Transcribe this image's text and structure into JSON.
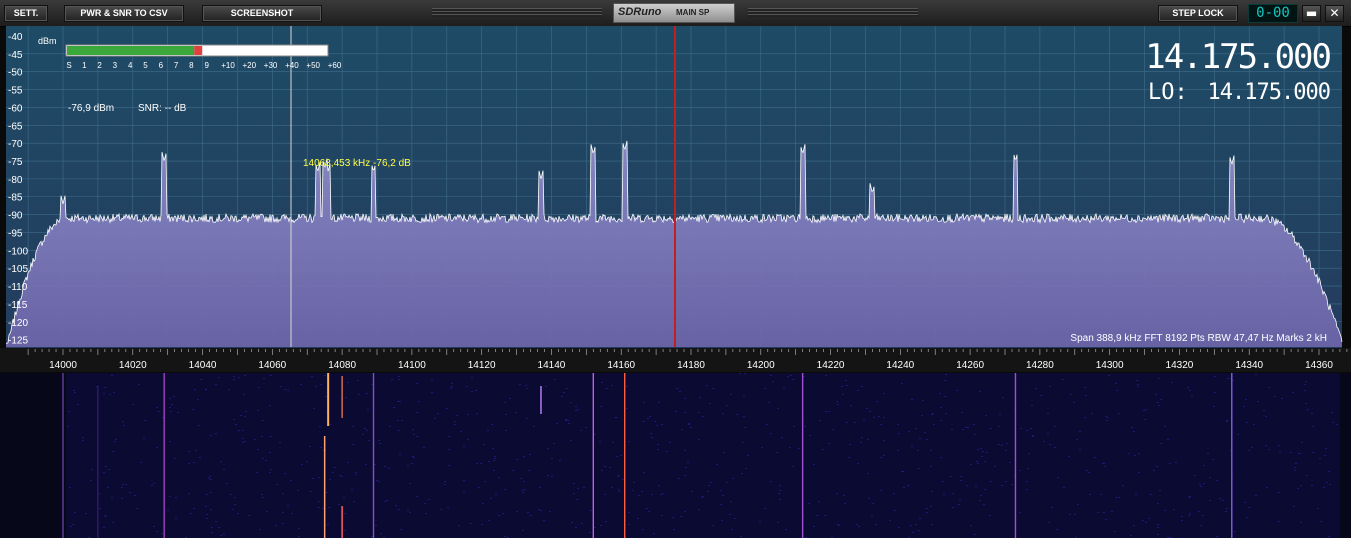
{
  "toolbar": {
    "settings_label": "SETT.",
    "csv_label": "PWR & SNR TO CSV",
    "screenshot_label": "SCREENSHOT",
    "brand_logo": "SDRuno",
    "brand_sub": "MAIN SP",
    "step_lock_label": "STEP LOCK",
    "clock": "0-00",
    "minimize_label": "▬",
    "close_label": "✕"
  },
  "spectrum": {
    "dbm_unit": "dBm",
    "y_ticks": [
      "-40",
      "-45",
      "-50",
      "-55",
      "-60",
      "-65",
      "-70",
      "-75",
      "-80",
      "-85",
      "-90",
      "-95",
      "-100",
      "-105",
      "-110",
      "-115",
      "-120",
      "-125"
    ],
    "x_ticks": [
      "14000",
      "14020",
      "14040",
      "14060",
      "14080",
      "14100",
      "14120",
      "14140",
      "14160",
      "14180",
      "14200",
      "14220",
      "14240",
      "14260",
      "14280",
      "14300",
      "14320",
      "14340",
      "14360"
    ],
    "smeter_scale": [
      "S",
      "1",
      "2",
      "3",
      "4",
      "5",
      "6",
      "7",
      "8",
      "9",
      "+10",
      "+20",
      "+30",
      "+40",
      "+50",
      "+60"
    ],
    "smeter_level": 0.52,
    "power_readout": "-76,9 dBm",
    "snr_readout": "SNR: -- dB",
    "cursor_readout": "14063,453 kHz -76,2 dB",
    "freq_main": "14.175.000",
    "lo_label": "LO:",
    "freq_lo": "14.175.000",
    "status_line": "Span 388,9 kHz   FFT 8192 Pts   RBW 47,47 Hz   Marks 2 kH",
    "colors": {
      "background": "#1f4a63",
      "grid": "#3f6d8a",
      "fill": "#7a7ab8",
      "trace": "#ffffff",
      "marker": "#c02020",
      "cursor": "#d8d8d8",
      "label_text": "#ffffff",
      "cursor_text": "#ffff44"
    }
  }
}
